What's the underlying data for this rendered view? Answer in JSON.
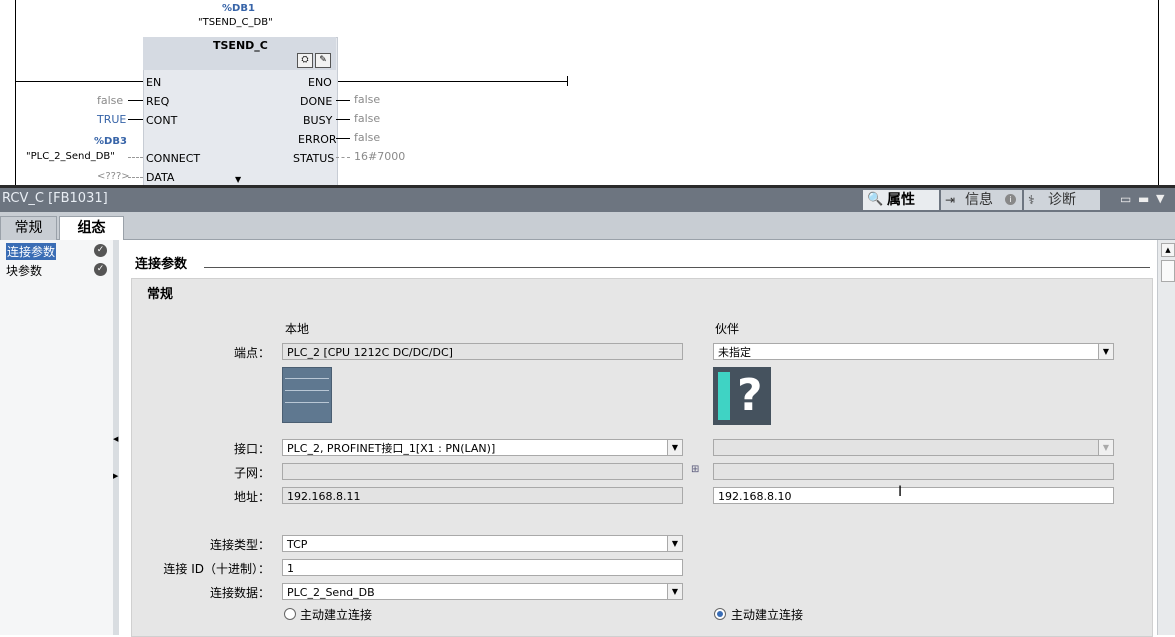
{
  "ladder": {
    "db_number": "%DB1",
    "db_name": "\"TSEND_C_DB\"",
    "block_name": "TSEND_C",
    "en": "EN",
    "eno": "ENO",
    "pins_left": [
      {
        "name": "REQ",
        "value": "false"
      },
      {
        "name": "CONT",
        "value": "TRUE"
      },
      {
        "name": "CONNECT",
        "value": "\"PLC_2_Send_DB\"",
        "db": "%DB3"
      },
      {
        "name": "DATA",
        "value": "<???>"
      }
    ],
    "pins_right": [
      {
        "name": "DONE",
        "value": "false"
      },
      {
        "name": "BUSY",
        "value": "false"
      },
      {
        "name": "ERROR",
        "value": "false"
      },
      {
        "name": "STATUS",
        "value": "16#7000"
      }
    ]
  },
  "inspector": {
    "title": "RCV_C [FB1031]",
    "tabs": [
      {
        "label": "属性",
        "icon": "magnifier-icon"
      },
      {
        "label": "信息",
        "icon": "info-icon"
      },
      {
        "label": "诊断",
        "icon": "diagnostics-icon"
      }
    ],
    "subtabs": [
      "常规",
      "组态"
    ],
    "nav": [
      "连接参数",
      "块参数"
    ]
  },
  "section": {
    "heading": "连接参数",
    "group": "常规",
    "col_local": "本地",
    "col_partner": "伙伴",
    "rows": {
      "endpoint_label": "端点：",
      "endpoint_local": "PLC_2 [CPU 1212C DC/DC/DC]",
      "endpoint_partner": "未指定",
      "interface_label": "接口：",
      "interface_local": "PLC_2, PROFINET接口_1[X1 : PN(LAN)]",
      "interface_partner": "",
      "subnet_label": "子网：",
      "subnet_local": "",
      "subnet_partner": "",
      "address_label": "地址：",
      "address_local": "192.168.8.11",
      "address_partner": "192.168.8.10",
      "conn_type_label": "连接类型：",
      "conn_type": "TCP",
      "conn_id_label": "连接 ID（十进制）：",
      "conn_id": "1",
      "conn_data_label": "连接数据：",
      "conn_data": "PLC_2_Send_DB",
      "active_local": "主动建立连接",
      "active_partner": "主动建立连接"
    }
  },
  "colors": {
    "accent": "#3a6db5",
    "titlebar": "#6d7580"
  }
}
